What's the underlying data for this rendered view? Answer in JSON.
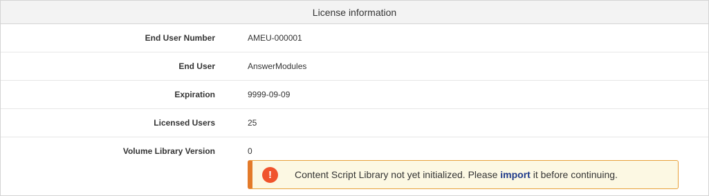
{
  "panel": {
    "title": "License information"
  },
  "rows": [
    {
      "label": "End User Number",
      "value": "AMEU-000001"
    },
    {
      "label": "End User",
      "value": "AnswerModules"
    },
    {
      "label": "Expiration",
      "value": "9999-09-09"
    },
    {
      "label": "Licensed Users",
      "value": "25"
    },
    {
      "label": "Volume Library Version",
      "value": "0"
    }
  ],
  "alert": {
    "icon": "exclamation-icon",
    "icon_glyph": "!",
    "text_before": "Content Script Library not yet initialized. Please ",
    "link_label": "import",
    "text_after": " it before continuing.",
    "colors": {
      "background": "#fcf8e3",
      "border": "#e8a13a",
      "accent": "#e37a2a",
      "icon": "#f0542d",
      "link": "#1f3a8a"
    }
  }
}
